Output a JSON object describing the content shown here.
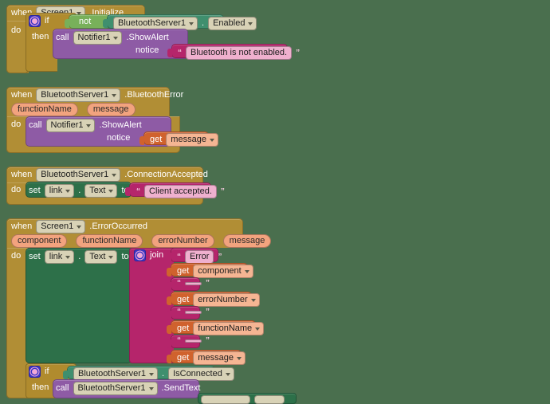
{
  "workspace": {
    "background_color": "#4a6f4e",
    "app": "MIT App Inventor Blocks Editor"
  },
  "palette": {
    "event_block": "#b18e35",
    "control_block": "#b08b2e",
    "logic_block": "#78b05a",
    "component_getter": "#3f8f6e",
    "component_setter": "#2d7049",
    "method_call": "#8e5ba5",
    "text_block": "#b5256b",
    "variable_get": "#d0622d",
    "mutator_icon": "#3b36c7"
  },
  "labels": {
    "when": "when",
    "do": "do",
    "if": "if",
    "then": "then",
    "call": "call",
    "set": "set",
    "to": "to",
    "get": "get",
    "not": "not",
    "join": "join",
    "notice": "notice",
    "dot": "."
  },
  "blocks": [
    {
      "id": "screen1-initialize",
      "type": "event",
      "component": "Screen1",
      "event": ".Initialize",
      "params": [],
      "body": {
        "type": "control-if",
        "condition": {
          "type": "logic-not",
          "operand": {
            "component": "BluetoothServer1",
            "property": "Enabled"
          }
        },
        "then": {
          "type": "method-call",
          "component": "Notifier1",
          "method": ".ShowAlert",
          "arg_label": "notice",
          "arg_value": {
            "type": "text",
            "value": "Bluetooth is not enabled."
          }
        }
      }
    },
    {
      "id": "bluetoothserver1-bluetootherror",
      "type": "event",
      "component": "BluetoothServer1",
      "event": ".BluetoothError",
      "params": [
        "functionName",
        "message"
      ],
      "body": {
        "type": "method-call",
        "component": "Notifier1",
        "method": ".ShowAlert",
        "arg_label": "notice",
        "arg_value": {
          "type": "variable-get",
          "name": "message"
        }
      }
    },
    {
      "id": "bluetoothserver1-connectionaccepted",
      "type": "event",
      "component": "BluetoothServer1",
      "event": ".ConnectionAccepted",
      "params": [],
      "body": {
        "type": "setter",
        "component": "link",
        "property": "Text",
        "value": {
          "type": "text",
          "value": "Client accepted."
        }
      }
    },
    {
      "id": "screen1-erroroccurred",
      "type": "event",
      "component": "Screen1",
      "event": ".ErrorOccurred",
      "params": [
        "component",
        "functionName",
        "errorNumber",
        "message"
      ],
      "body": {
        "type": "setter",
        "component": "link",
        "property": "Text",
        "value": {
          "type": "join",
          "items": [
            {
              "type": "text",
              "value": "Error"
            },
            {
              "type": "variable-get",
              "name": "component"
            },
            {
              "type": "text",
              "value": " "
            },
            {
              "type": "variable-get",
              "name": "errorNumber"
            },
            {
              "type": "text",
              "value": " "
            },
            {
              "type": "variable-get",
              "name": "functionName"
            },
            {
              "type": "text",
              "value": " "
            },
            {
              "type": "variable-get",
              "name": "message"
            }
          ]
        }
      },
      "next": {
        "type": "control-if",
        "condition": {
          "component": "BluetoothServer1",
          "property": "IsConnected"
        },
        "then": {
          "type": "method-call",
          "component": "BluetoothServer1",
          "method": ".SendText"
        }
      }
    }
  ]
}
